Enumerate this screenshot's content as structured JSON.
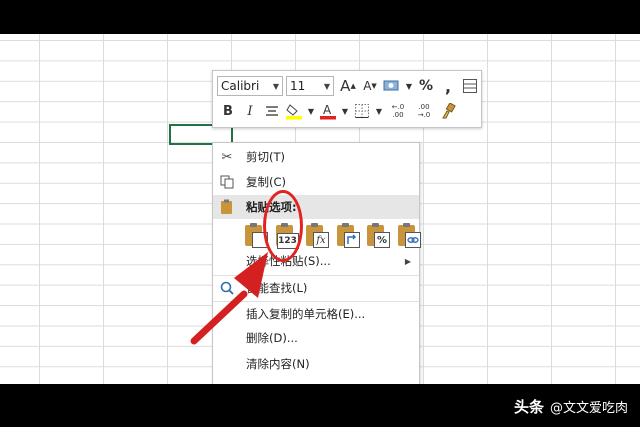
{
  "mini_toolbar": {
    "font_name": "Calibri",
    "font_size": "11",
    "grow_font": "A",
    "shrink_font": "A",
    "percent": "%",
    "comma": ",",
    "bold": "B",
    "italic": "I",
    "decrease_decimal_a": "←.0",
    "decrease_decimal_b": ".00",
    "increase_decimal_a": ".00",
    "increase_decimal_b": "→.0"
  },
  "context_menu": {
    "cut": "剪切(T)",
    "copy": "复制(C)",
    "paste_options": "粘贴选项:",
    "paste_values_label": "123",
    "paste_formula_label": "fx",
    "paste_percent_label": "%",
    "paste_special": "选择性粘贴(S)...",
    "smart_lookup": "智能查找(L)",
    "insert_copied": "插入复制的单元格(E)...",
    "delete": "删除(D)...",
    "clear_contents": "清除内容(N)"
  },
  "watermark": {
    "source": "头条",
    "author": "@文文爱吃肉"
  },
  "colors": {
    "highlight_yellow": "#ffff00",
    "font_red": "#e32222",
    "selection_green": "#217346"
  }
}
